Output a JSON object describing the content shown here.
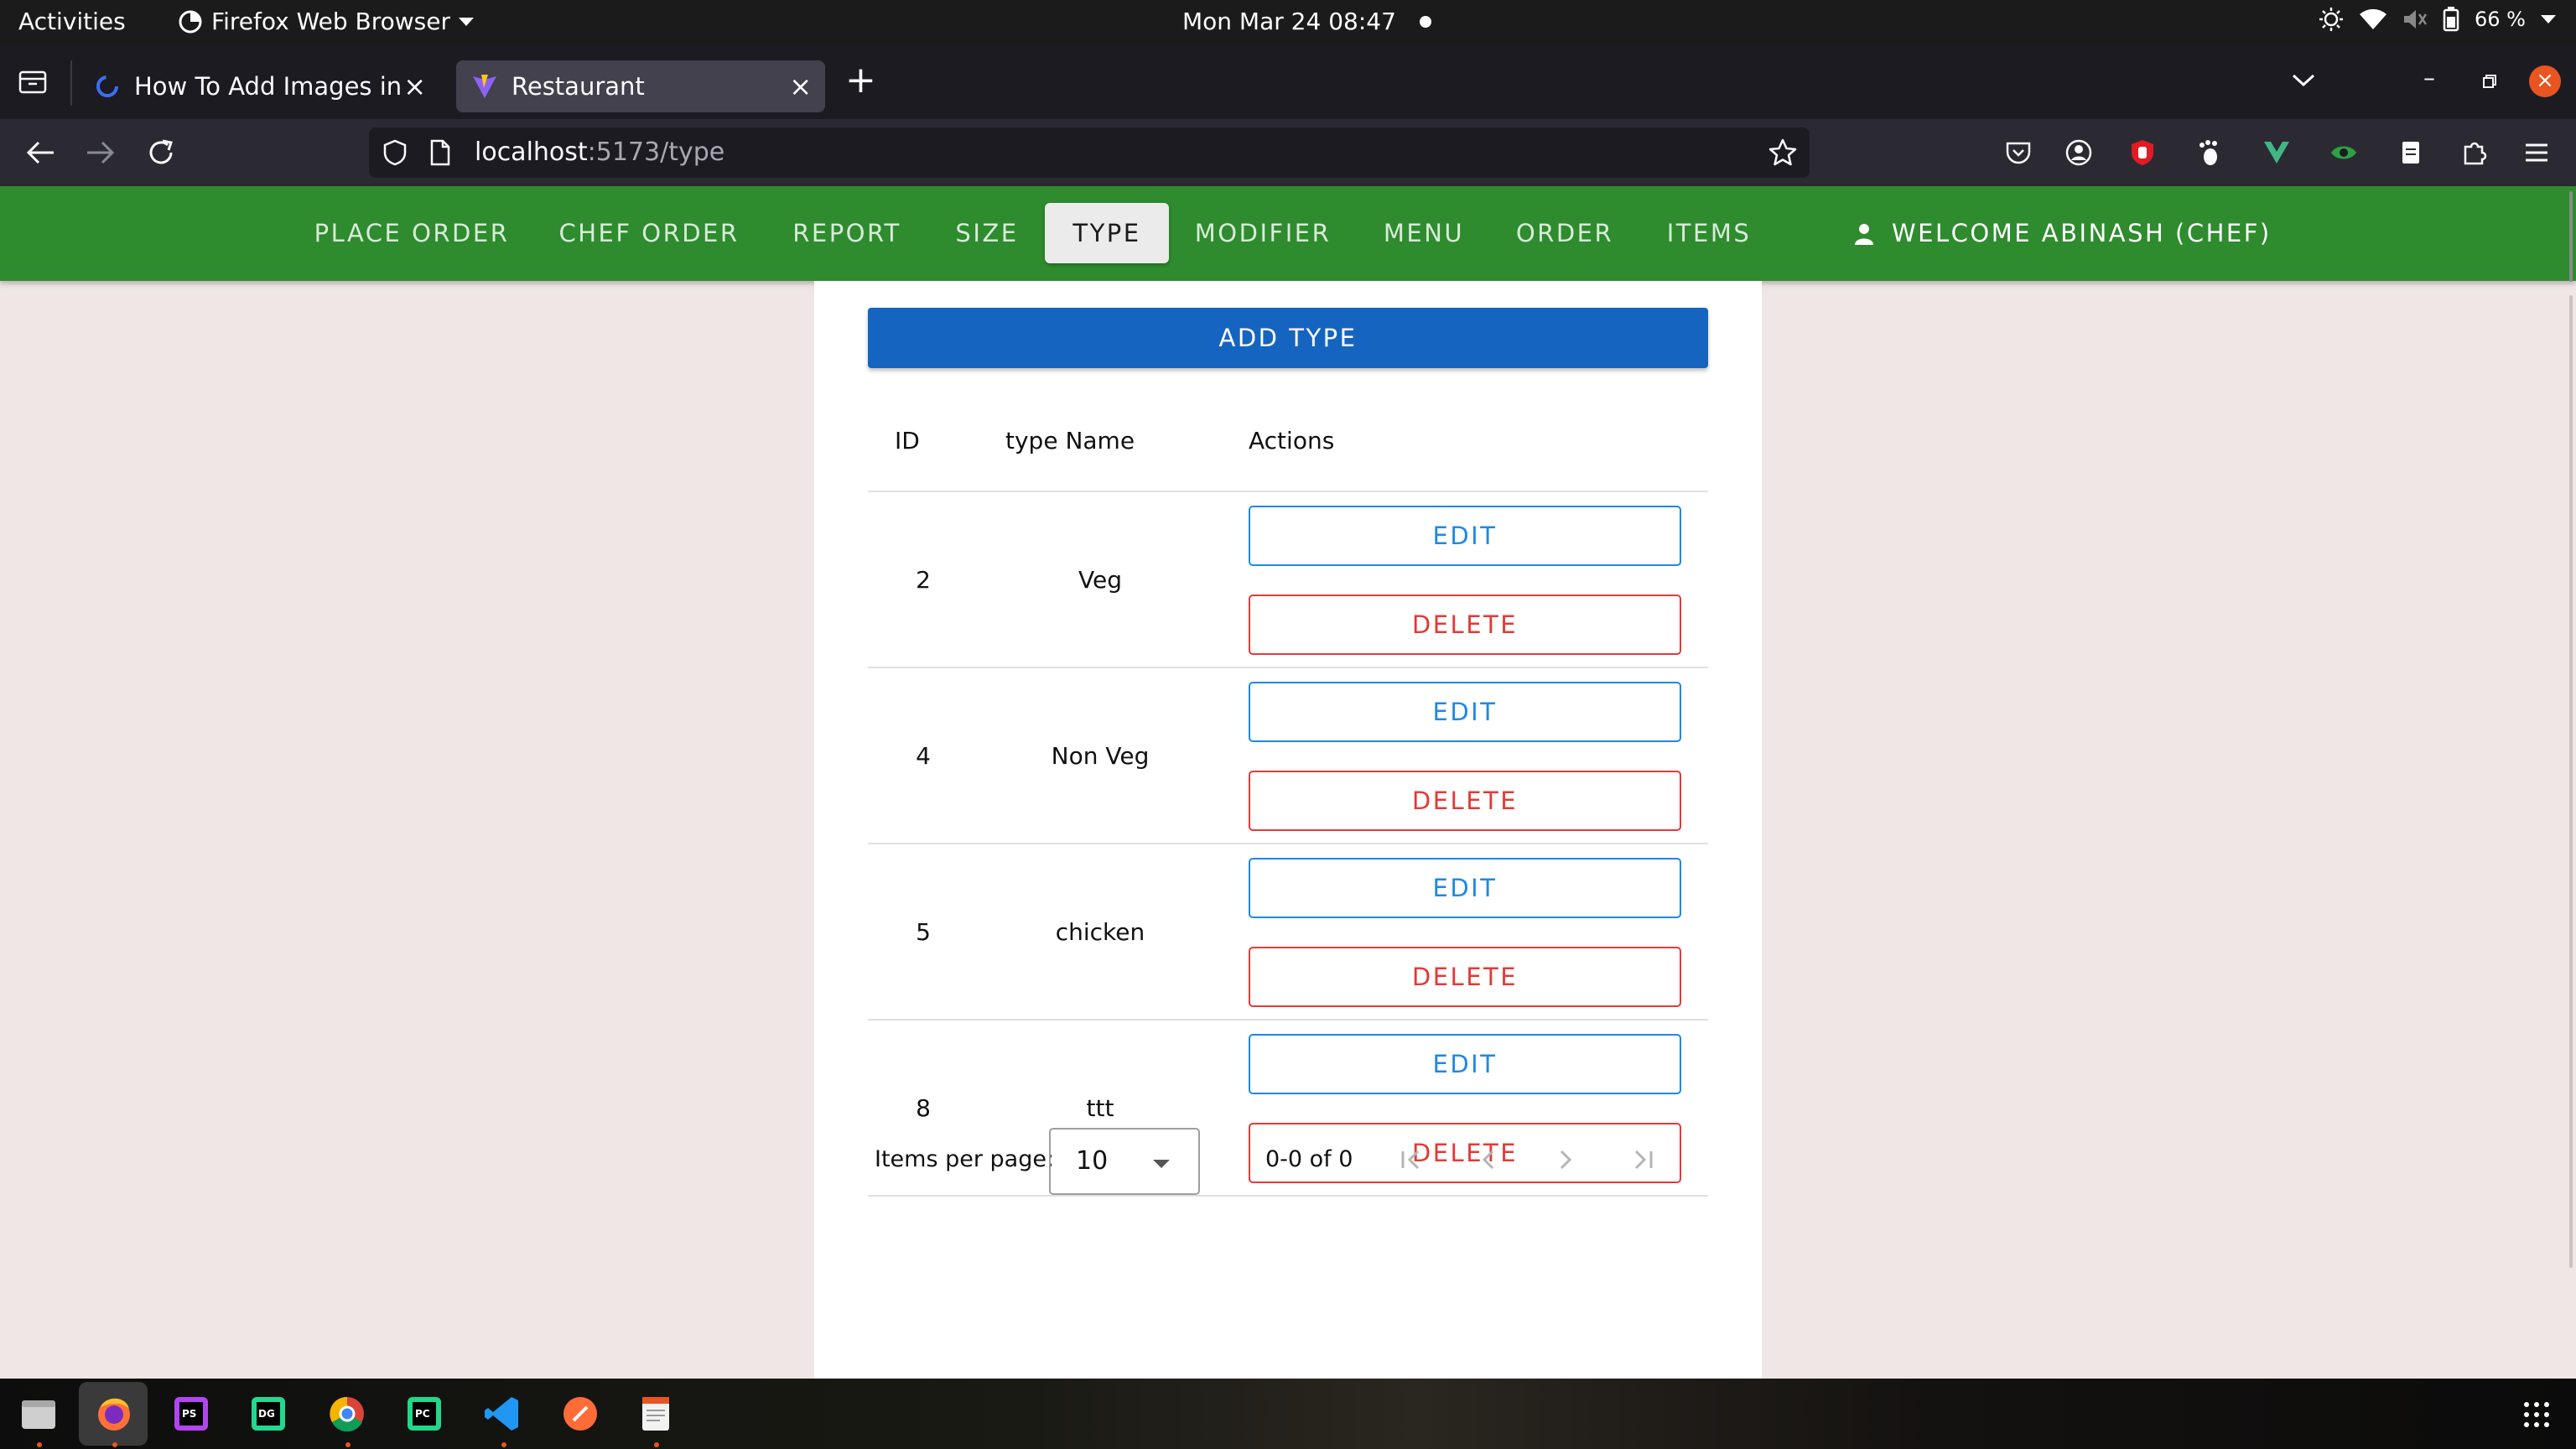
{
  "system": {
    "activities": "Activities",
    "app_name": "Firefox Web Browser",
    "clock": "Mon Mar 24  08:47",
    "battery": "66 %"
  },
  "browser": {
    "tabs": [
      {
        "title": "How To Add Images in Ma",
        "favicon": "loading-spinner-icon"
      },
      {
        "title": "Restaurant",
        "favicon": "vite-icon",
        "active": true
      }
    ],
    "url_host": "localhost",
    "url_path": ":5173/type",
    "extensions": [
      "pocket-icon",
      "account-icon",
      "ublock-icon",
      "gnome-foot-icon",
      "vue-devtools-icon",
      "eye-extension-icon",
      "clipboard-icon",
      "extensions-puzzle-icon",
      "hamburger-menu-icon"
    ]
  },
  "appbar": {
    "menu": [
      "PLACE ORDER",
      "CHEF ORDER",
      "REPORT",
      "SIZE",
      "TYPE",
      "MODIFIER",
      "MENU",
      "ORDER",
      "ITEMS"
    ],
    "active": "TYPE",
    "welcome": "WELCOME ABINASH (CHEF)",
    "accent": "#2e8b2e"
  },
  "main": {
    "add_button": "ADD TYPE",
    "table": {
      "headers": [
        "ID",
        "type Name",
        "Actions"
      ],
      "rows": [
        {
          "id": "2",
          "name": "Veg"
        },
        {
          "id": "4",
          "name": "Non Veg"
        },
        {
          "id": "5",
          "name": "chicken"
        },
        {
          "id": "8",
          "name": "ttt"
        }
      ],
      "edit_label": "EDIT",
      "delete_label": "DELETE"
    },
    "pagination": {
      "items_per_page_label": "Items per page:",
      "items_per_page": "10",
      "range": "0-0 of 0"
    }
  },
  "dock": {
    "apps": [
      "files-icon",
      "firefox-icon",
      "phpstorm-icon",
      "datagrip-icon",
      "chrome-icon",
      "pycharm-icon",
      "vscode-icon",
      "postman-icon",
      "text-editor-icon"
    ]
  }
}
